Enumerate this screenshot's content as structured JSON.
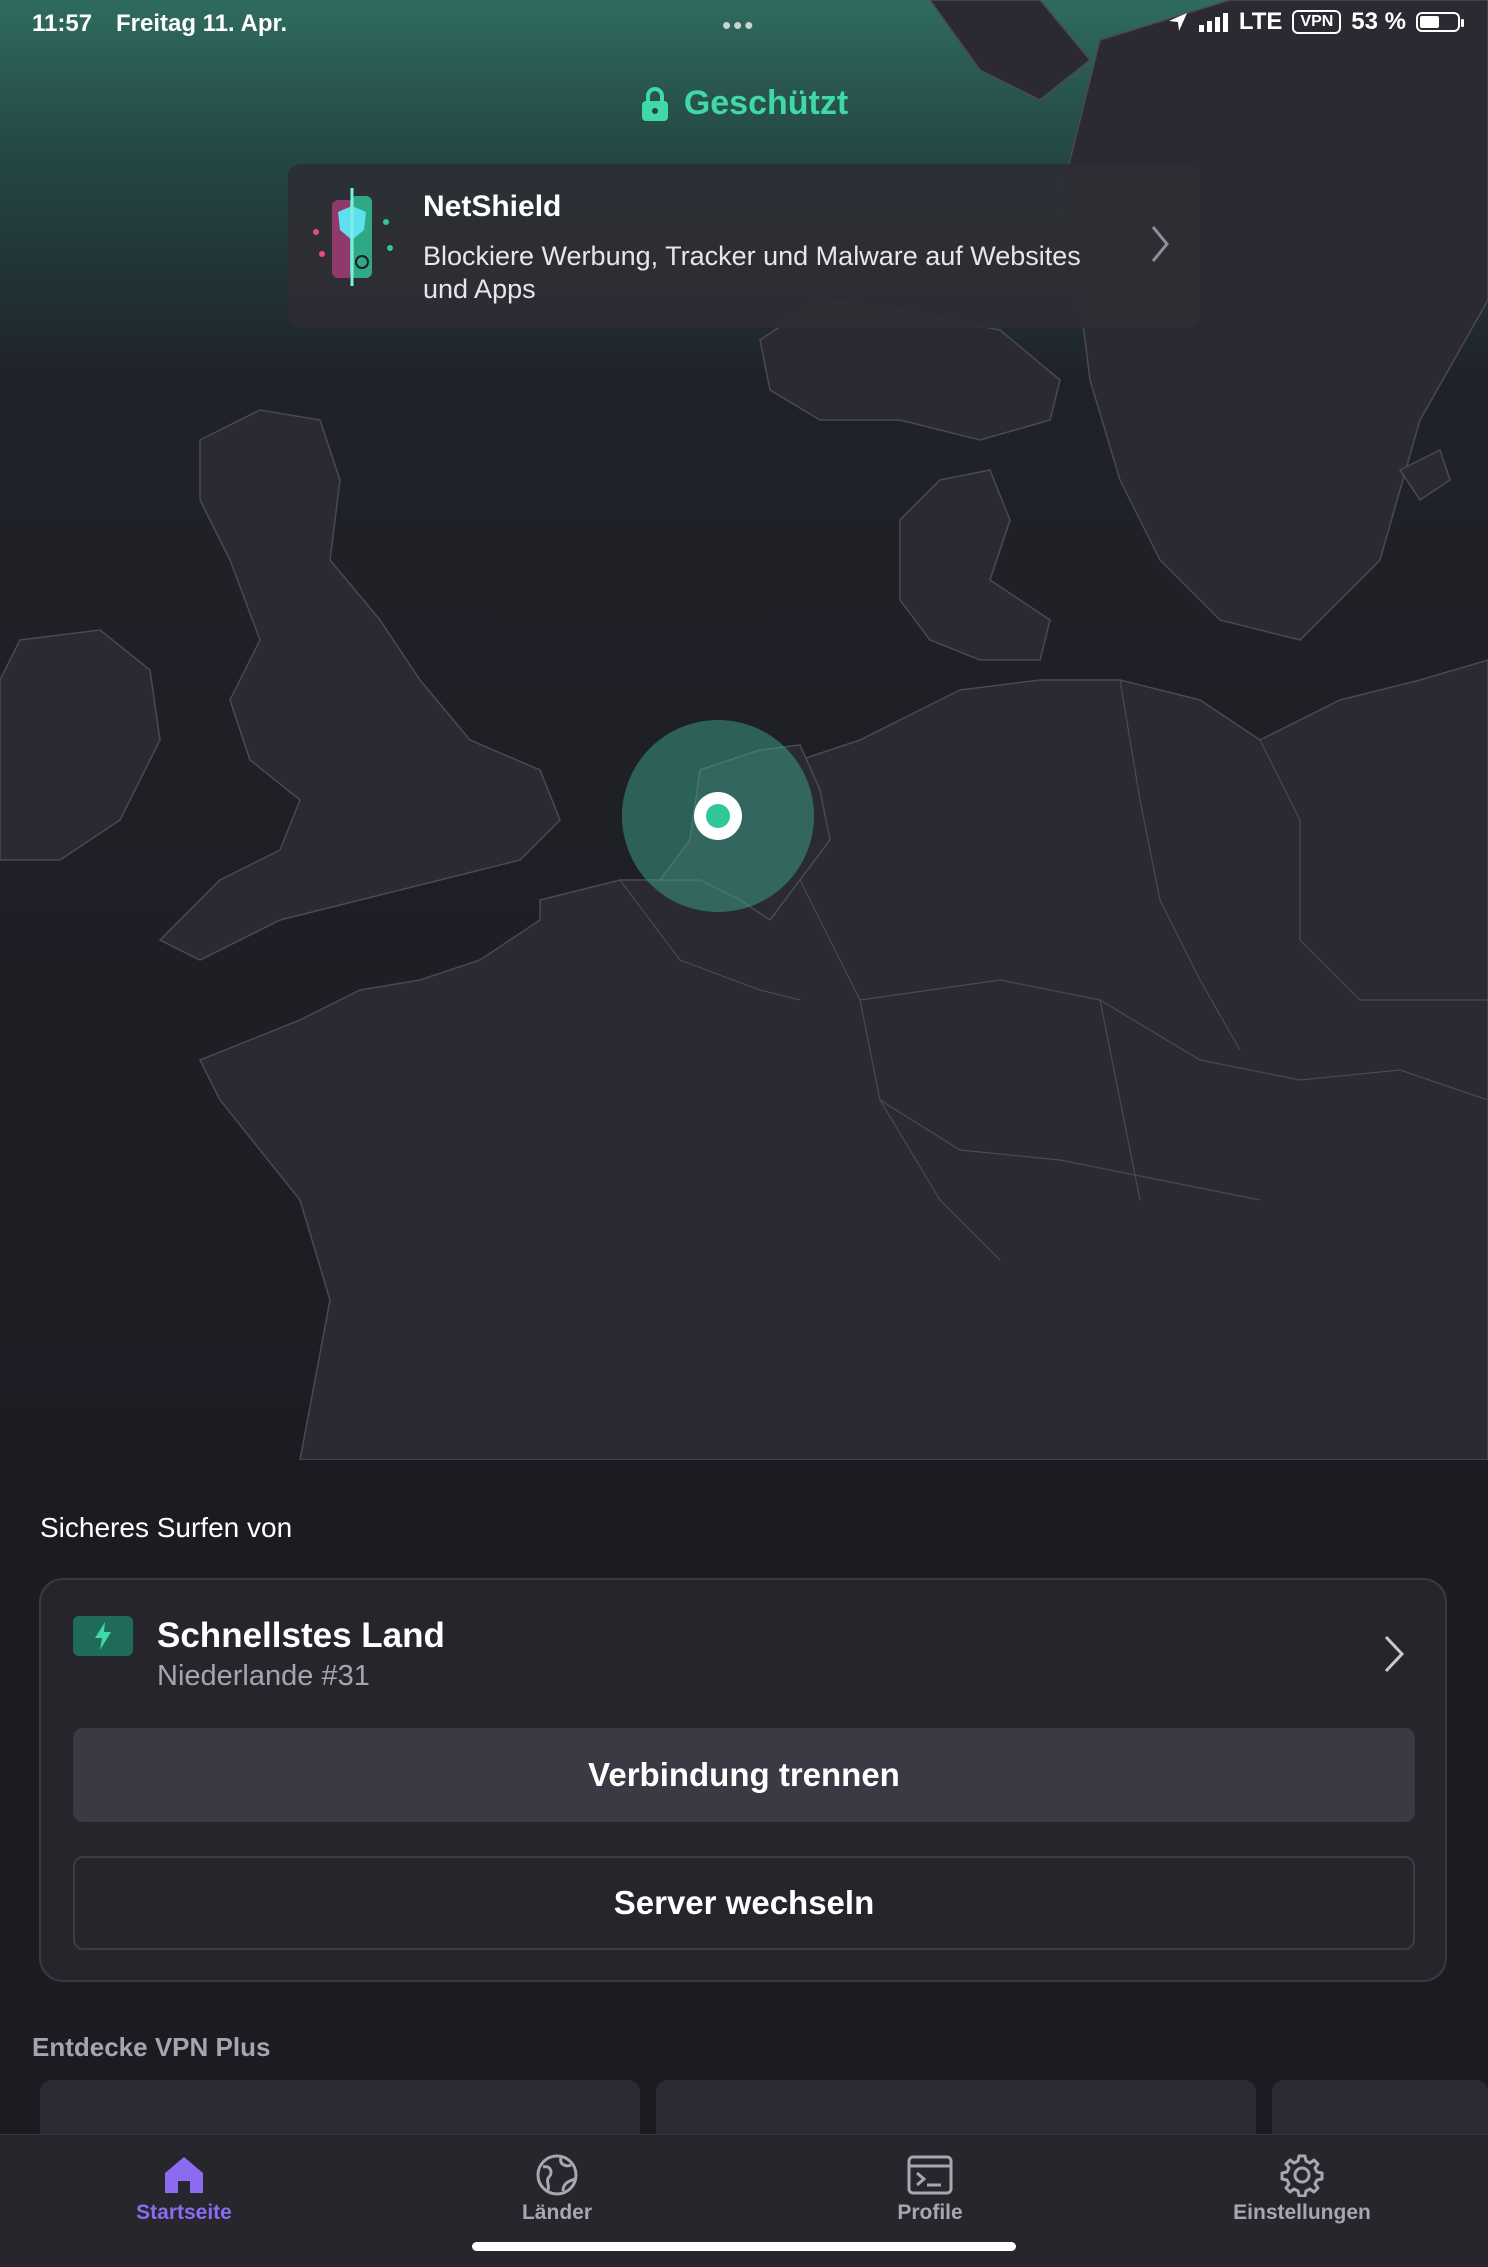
{
  "status_bar": {
    "time": "11:57",
    "date": "Freitag 11. Apr.",
    "network": "LTE",
    "vpn_badge": "VPN",
    "battery": "53 %",
    "battery_level": 0.53
  },
  "connection": {
    "status": "Geschützt",
    "accent_color": "#3fd8a6"
  },
  "netshield": {
    "title": "NetShield",
    "description": "Blockiere Werbung, Tracker und Malware auf Websites und Apps"
  },
  "main": {
    "secure_label": "Sicheres Surfen von",
    "server_title": "Schnellstes Land",
    "server_subtitle": "Niederlande #31",
    "disconnect_label": "Verbindung trennen",
    "switch_label": "Server wechseln",
    "discover_label": "Entdecke VPN Plus"
  },
  "tabs": [
    {
      "label": "Startseite",
      "icon": "home-icon",
      "active": true
    },
    {
      "label": "Länder",
      "icon": "globe-icon",
      "active": false
    },
    {
      "label": "Profile",
      "icon": "terminal-icon",
      "active": false
    },
    {
      "label": "Einstellungen",
      "icon": "gear-icon",
      "active": false
    }
  ]
}
